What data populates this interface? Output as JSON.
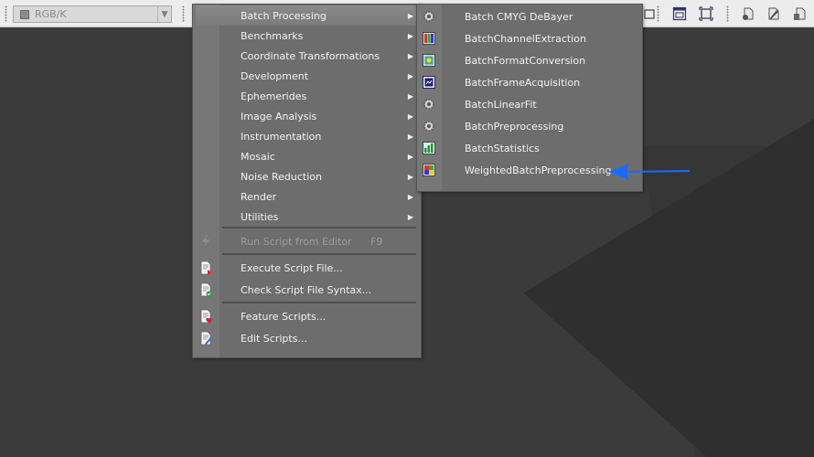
{
  "toolbar": {
    "color_mode": "RGB/K",
    "icons": [
      "window-icon",
      "fit-view-icon",
      "script-new-icon",
      "script-edit-icon",
      "duplicate-icon"
    ]
  },
  "menu": {
    "items": [
      {
        "label": "Batch Processing",
        "submenu": true
      },
      {
        "label": "Benchmarks",
        "submenu": true
      },
      {
        "label": "Coordinate Transformations",
        "submenu": true
      },
      {
        "label": "Development",
        "submenu": true
      },
      {
        "label": "Ephemerides",
        "submenu": true
      },
      {
        "label": "Image Analysis",
        "submenu": true
      },
      {
        "label": "Instrumentation",
        "submenu": true
      },
      {
        "label": "Mosaic",
        "submenu": true
      },
      {
        "label": "Noise Reduction",
        "submenu": true
      },
      {
        "label": "Render",
        "submenu": true
      },
      {
        "label": "Utilities",
        "submenu": true
      }
    ],
    "run_script": {
      "label": "Run Script from Editor",
      "shortcut": "F9"
    },
    "execute_script": "Execute Script File...",
    "check_syntax": "Check Script File Syntax...",
    "feature_scripts": "Feature Scripts...",
    "edit_scripts": "Edit Scripts..."
  },
  "submenu": {
    "items": [
      {
        "label": "Batch CMYG DeBayer",
        "icon": "gear-icon"
      },
      {
        "label": "BatchChannelExtraction",
        "icon": "channels-icon"
      },
      {
        "label": "BatchFormatConversion",
        "icon": "format-icon"
      },
      {
        "label": "BatchFrameAcquisition",
        "icon": "acquisition-icon"
      },
      {
        "label": "BatchLinearFit",
        "icon": "gear-icon"
      },
      {
        "label": "BatchPreprocessing",
        "icon": "gear-icon"
      },
      {
        "label": "BatchStatistics",
        "icon": "statistics-icon"
      },
      {
        "label": "WeightedBatchPreprocessing",
        "icon": "weighted-icon"
      }
    ]
  },
  "colors": {
    "menu_bg": "#6d6d6d",
    "highlight": "#858585",
    "annotation_arrow": "#1a6cff"
  }
}
